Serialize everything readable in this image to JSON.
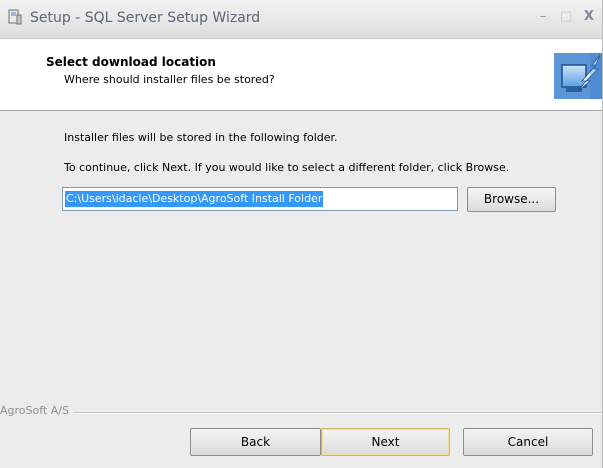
{
  "window": {
    "title": "Setup - SQL Server Setup Wizard",
    "controls": {
      "minimize": "–",
      "maximize": "□",
      "close": "X"
    }
  },
  "header": {
    "title": "Select download location",
    "subtitle": "Where should installer files be stored?",
    "graphic_icon": "computer-arrow-icon"
  },
  "body": {
    "line1": "Installer files will be stored in the following folder.",
    "line2": "To continue, click Next. If you would like to select a different folder, click Browse.",
    "folder_path": "C:\\Users\\idacle\\Desktop\\AgroSoft Install Folder",
    "browse_label": "Browse..."
  },
  "footer": {
    "brand": "AgroSoft A/S",
    "back_label": "Back",
    "next_label": "Next",
    "cancel_label": "Cancel"
  },
  "colors": {
    "selection": "#3399ff",
    "default_button_border": "#d9b563",
    "title_text": "#5a6576"
  }
}
